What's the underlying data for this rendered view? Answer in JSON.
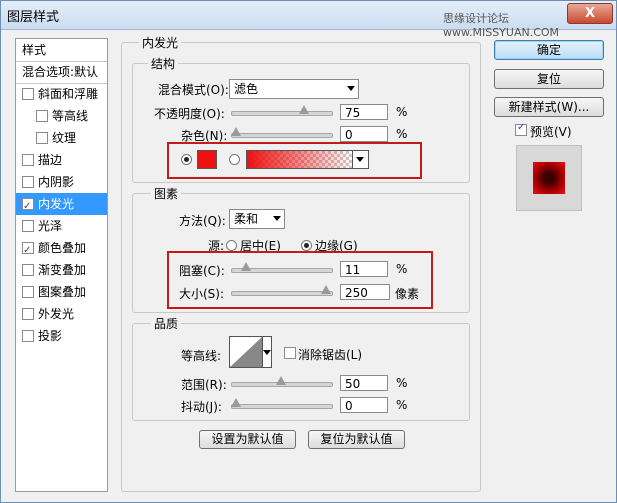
{
  "window": {
    "title": "图层样式",
    "watermark": "思缘设计论坛 www.MISSYUAN.COM",
    "close_label": "X"
  },
  "styles_list": {
    "header": "样式",
    "items": [
      {
        "label": "混合选项:默认",
        "checkbox": false,
        "checked": false,
        "indent": 0
      },
      {
        "label": "斜面和浮雕",
        "checkbox": true,
        "checked": false,
        "indent": 0
      },
      {
        "label": "等高线",
        "checkbox": true,
        "checked": false,
        "indent": 1
      },
      {
        "label": "纹理",
        "checkbox": true,
        "checked": false,
        "indent": 1
      },
      {
        "label": "描边",
        "checkbox": true,
        "checked": false,
        "indent": 0
      },
      {
        "label": "内阴影",
        "checkbox": true,
        "checked": false,
        "indent": 0
      },
      {
        "label": "内发光",
        "checkbox": true,
        "checked": true,
        "indent": 0,
        "selected": true
      },
      {
        "label": "光泽",
        "checkbox": true,
        "checked": false,
        "indent": 0
      },
      {
        "label": "颜色叠加",
        "checkbox": true,
        "checked": true,
        "indent": 0
      },
      {
        "label": "渐变叠加",
        "checkbox": true,
        "checked": false,
        "indent": 0
      },
      {
        "label": "图案叠加",
        "checkbox": true,
        "checked": false,
        "indent": 0
      },
      {
        "label": "外发光",
        "checkbox": true,
        "checked": false,
        "indent": 0
      },
      {
        "label": "投影",
        "checkbox": true,
        "checked": false,
        "indent": 0
      }
    ]
  },
  "panel": {
    "title": "内发光",
    "structure": {
      "title": "结构",
      "blend_mode_label": "混合模式(O):",
      "blend_mode_value": "滤色",
      "opacity_label": "不透明度(O):",
      "opacity_value": "75",
      "opacity_fraction": 0.75,
      "noise_label": "杂色(N):",
      "noise_value": "0",
      "noise_fraction": 0,
      "unit": "%",
      "glow_color": "#ee1111"
    },
    "elements": {
      "title": "图素",
      "technique_label": "方法(Q):",
      "technique_value": "柔和",
      "source_label": "源:",
      "source_center": "居中(E)",
      "source_edge": "边缘(G)",
      "choke_label": "阻塞(C):",
      "choke_value": "11",
      "choke_fraction": 0.11,
      "size_label": "大小(S):",
      "size_value": "250",
      "size_fraction": 1.0,
      "size_unit": "像素",
      "unit": "%"
    },
    "quality": {
      "title": "品质",
      "contour_label": "等高线:",
      "antialias_label": "消除锯齿(L)",
      "range_label": "范围(R):",
      "range_value": "50",
      "range_fraction": 0.5,
      "jitter_label": "抖动(J):",
      "jitter_value": "0",
      "jitter_fraction": 0,
      "unit": "%"
    },
    "set_default": "设置为默认值",
    "reset_default": "复位为默认值"
  },
  "actions": {
    "ok": "确定",
    "reset": "复位",
    "new_style": "新建样式(W)...",
    "preview": "预览(V)",
    "preview_checked": true
  }
}
